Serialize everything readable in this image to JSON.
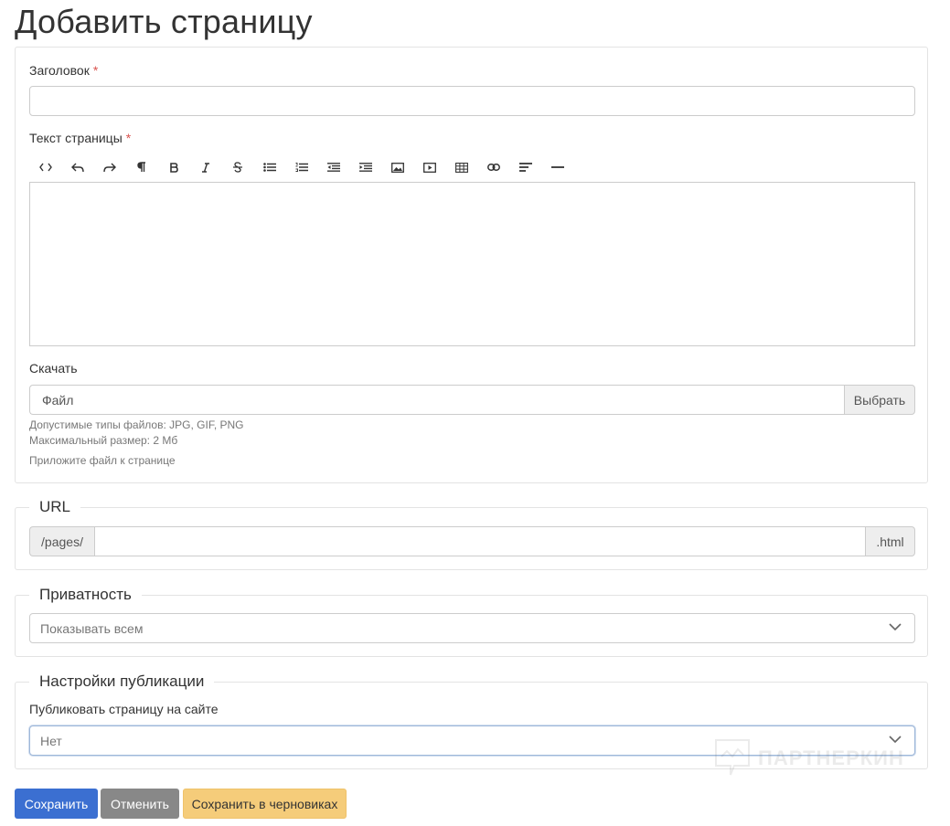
{
  "page": {
    "title": "Добавить страницу"
  },
  "form": {
    "title_label": "Заголовок",
    "required_mark": "*",
    "title_value": "",
    "text_label": "Текст страницы",
    "toolbar": [
      {
        "name": "html-icon"
      },
      {
        "name": "undo-icon"
      },
      {
        "name": "redo-icon"
      },
      {
        "name": "paragraph-icon"
      },
      {
        "name": "bold-icon"
      },
      {
        "name": "italic-icon"
      },
      {
        "name": "strikethrough-icon"
      },
      {
        "name": "unordered-list-icon"
      },
      {
        "name": "ordered-list-icon"
      },
      {
        "name": "outdent-icon"
      },
      {
        "name": "indent-icon"
      },
      {
        "name": "image-icon"
      },
      {
        "name": "video-icon"
      },
      {
        "name": "table-icon"
      },
      {
        "name": "link-icon"
      },
      {
        "name": "align-icon"
      },
      {
        "name": "horizontal-rule-icon"
      }
    ],
    "download_label": "Скачать",
    "file_placeholder": "Файл",
    "file_button": "Выбрать",
    "file_types_help": "Допустимые типы файлов: JPG, GIF, PNG",
    "file_size_help": "Максимальный размер: 2 Мб",
    "attach_help": "Приложите файл к странице"
  },
  "url": {
    "legend": "URL",
    "prefix": "/pages/",
    "value": "",
    "suffix": ".html"
  },
  "privacy": {
    "legend": "Приватность",
    "selected": "Показывать всем"
  },
  "publish": {
    "legend": "Настройки публикации",
    "label": "Публиковать страницу на сайте",
    "selected": "Нет"
  },
  "actions": {
    "save": "Сохранить",
    "cancel": "Отменить",
    "draft": "Сохранить в черновиках"
  },
  "colors": {
    "save": "#3b6fd1",
    "cancel": "#888888",
    "draft": "#f5cc7a",
    "required": "#d9534f"
  },
  "watermark": {
    "text": "ПАРТНЕРКИН"
  }
}
